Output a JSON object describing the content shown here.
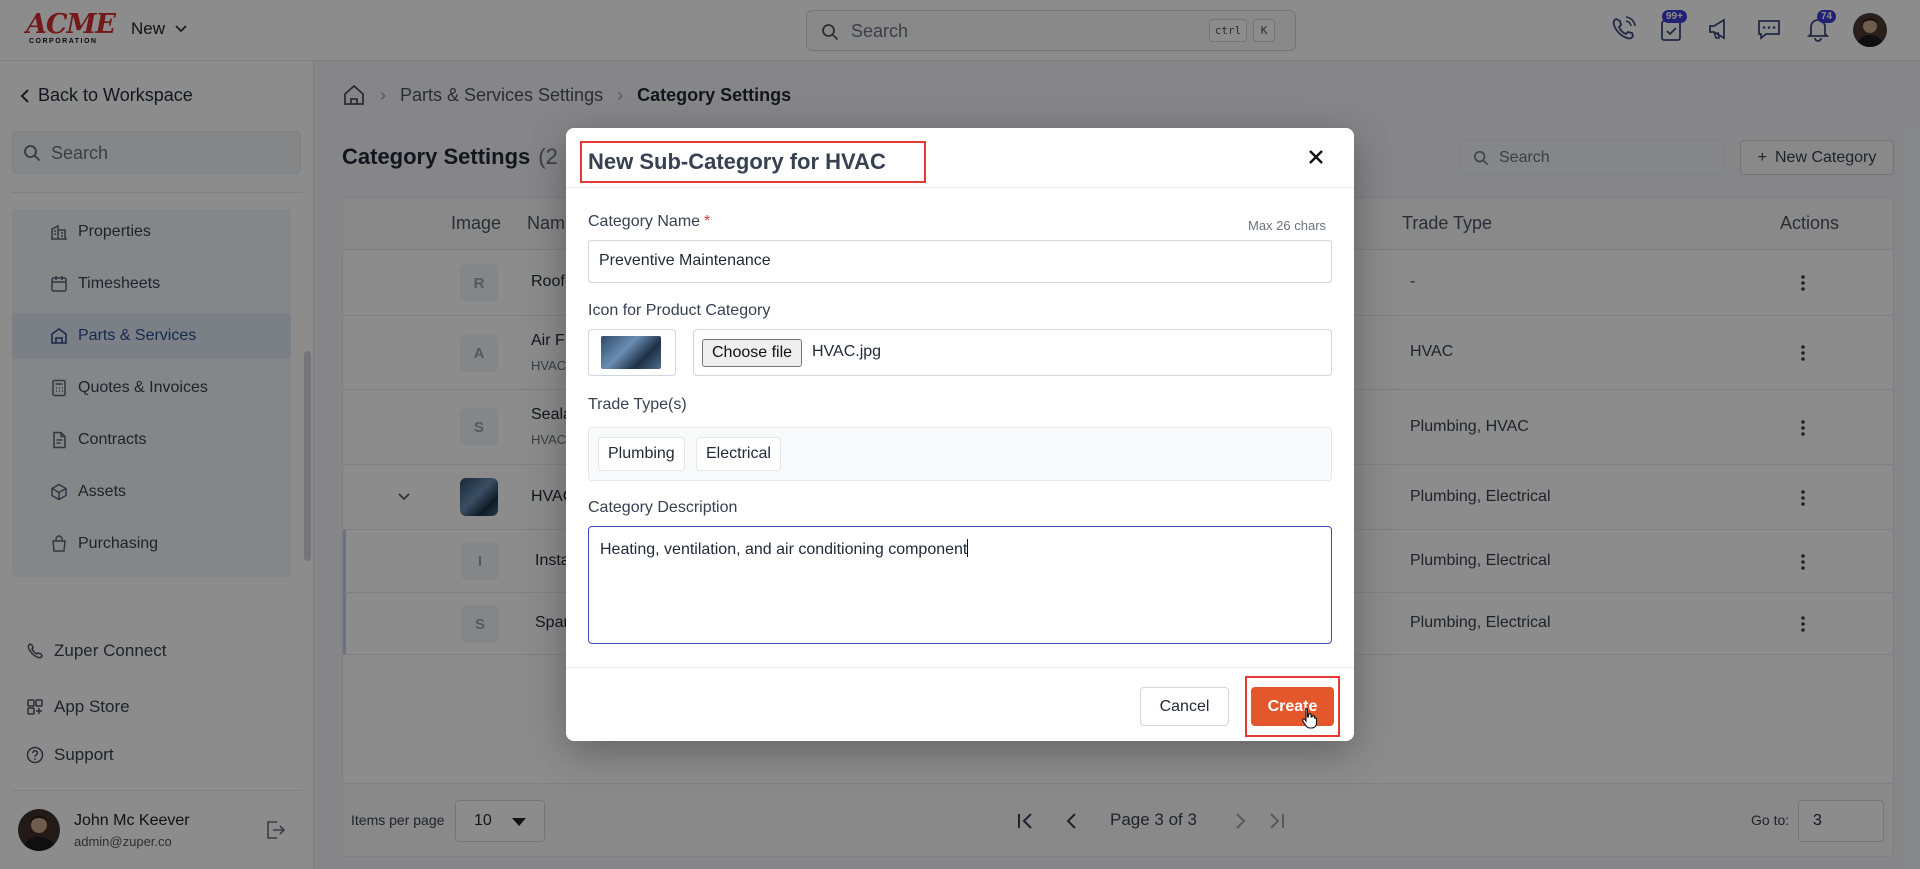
{
  "app": {
    "logo_main": "ACME",
    "logo_sub": "CORPORATION",
    "new_label": "New",
    "search_placeholder": "Search",
    "kbd_ctrl": "ctrl",
    "kbd_k": "K",
    "badge_tasks": "99+",
    "badge_notifications": "74"
  },
  "sidebar": {
    "back_label": "Back to Workspace",
    "search_placeholder": "Search",
    "items": [
      {
        "label": "Properties",
        "icon": "building-icon"
      },
      {
        "label": "Timesheets",
        "icon": "calendar-icon"
      },
      {
        "label": "Parts & Services",
        "icon": "parts-icon"
      },
      {
        "label": "Quotes & Invoices",
        "icon": "calculator-icon"
      },
      {
        "label": "Contracts",
        "icon": "contract-icon"
      },
      {
        "label": "Assets",
        "icon": "cube-icon"
      },
      {
        "label": "Purchasing",
        "icon": "bag-icon"
      }
    ],
    "links": [
      {
        "label": "Zuper Connect",
        "icon": "phone-icon"
      },
      {
        "label": "App Store",
        "icon": "store-icon"
      },
      {
        "label": "Support",
        "icon": "help-icon"
      }
    ],
    "user": {
      "name": "John Mc Keever",
      "email": "admin@zuper.co"
    }
  },
  "breadcrumb": {
    "home_icon": "home-icon",
    "items": [
      "Parts & Services Settings",
      "Category Settings"
    ]
  },
  "page": {
    "title": "Category Settings",
    "count": "(2",
    "search_placeholder": "Search",
    "new_category_label": "New Category"
  },
  "table": {
    "headers": {
      "image": "Image",
      "name": "Nam",
      "trade": "Trade Type",
      "actions": "Actions"
    },
    "rows": [
      {
        "initial": "R",
        "name": "Roof",
        "sub": "",
        "trade": "-"
      },
      {
        "initial": "A",
        "name": "Air F",
        "sub": "HVAC",
        "trade": "HVAC"
      },
      {
        "initial": "S",
        "name": "Seala",
        "sub": "HVAC",
        "trade": "Plumbing, HVAC"
      },
      {
        "initial": "",
        "name": "HVAC",
        "sub": "",
        "trade": "Plumbing, Electrical"
      },
      {
        "initial": "I",
        "name": "Insta",
        "sub": "",
        "trade": "Plumbing, Electrical"
      },
      {
        "initial": "S",
        "name": "Spar",
        "sub": "",
        "trade": "Plumbing, Electrical"
      }
    ],
    "pager": {
      "items_per_page_label": "Items per page",
      "items_per_page": "10",
      "page_text": "Page 3 of 3",
      "goto_label": "Go to:",
      "goto_value": "3"
    }
  },
  "modal": {
    "title": "New Sub-Category for HVAC",
    "name_label": "Category Name",
    "required_mark": "*",
    "max_hint": "Max 26 chars",
    "name_value": "Preventive Maintenance",
    "icon_label": "Icon for Product Category",
    "choose_file": "Choose file",
    "file_name": "HVAC.jpg",
    "trade_label": "Trade Type(s)",
    "trades": [
      "Plumbing",
      "Electrical"
    ],
    "desc_label": "Category Description",
    "desc_value": "Heating, ventilation, and air conditioning component",
    "cancel_label": "Cancel",
    "create_label": "Create"
  },
  "colors": {
    "accent": "#e4562c",
    "highlight": "#e53935",
    "active_nav": "#2b4d8f"
  }
}
